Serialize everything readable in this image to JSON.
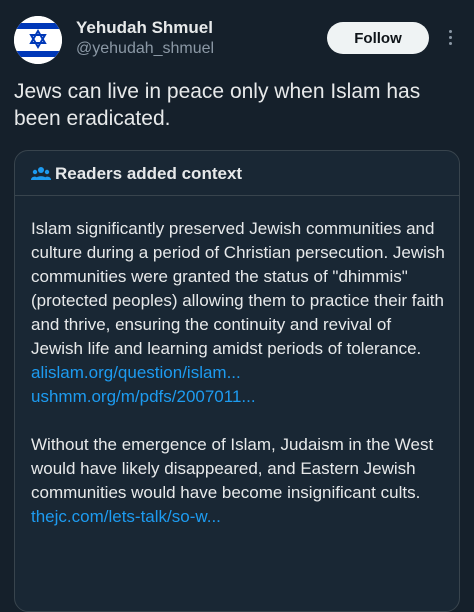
{
  "tweet": {
    "author": {
      "name": "Yehudah Shmuel",
      "handle": "@yehudah_shmuel",
      "avatar": "israel-flag"
    },
    "follow_label": "Follow",
    "more_icon": "more-vertical-icon",
    "text": "Jews can live in peace only when Islam has been eradicated."
  },
  "context": {
    "icon": "people-icon",
    "title": "Readers added context",
    "paragraph1": "Islam significantly preserved Jewish communities and culture during a period of Christian persecution. Jewish communities were granted the status of \"dhimmis\" (protected peoples) allowing them to practice their faith and thrive, ensuring the continuity and revival of Jewish life and learning amidst periods of tolerance.",
    "links1": [
      "alislam.org/question/islam...",
      "ushmm.org/m/pdfs/2007011..."
    ],
    "paragraph2": "Without the emergence of Islam, Judaism in the West would have likely disappeared, and Eastern Jewish communities would have become insignificant cults.",
    "links2": [
      "thejc.com/lets-talk/so-w..."
    ]
  },
  "colors": {
    "background": "#15202b",
    "card": "#192734",
    "border": "#38444d",
    "text": "#e7e9ea",
    "secondary": "#8b98a5",
    "link": "#1d9bf0",
    "flag_blue": "#0038b8"
  }
}
